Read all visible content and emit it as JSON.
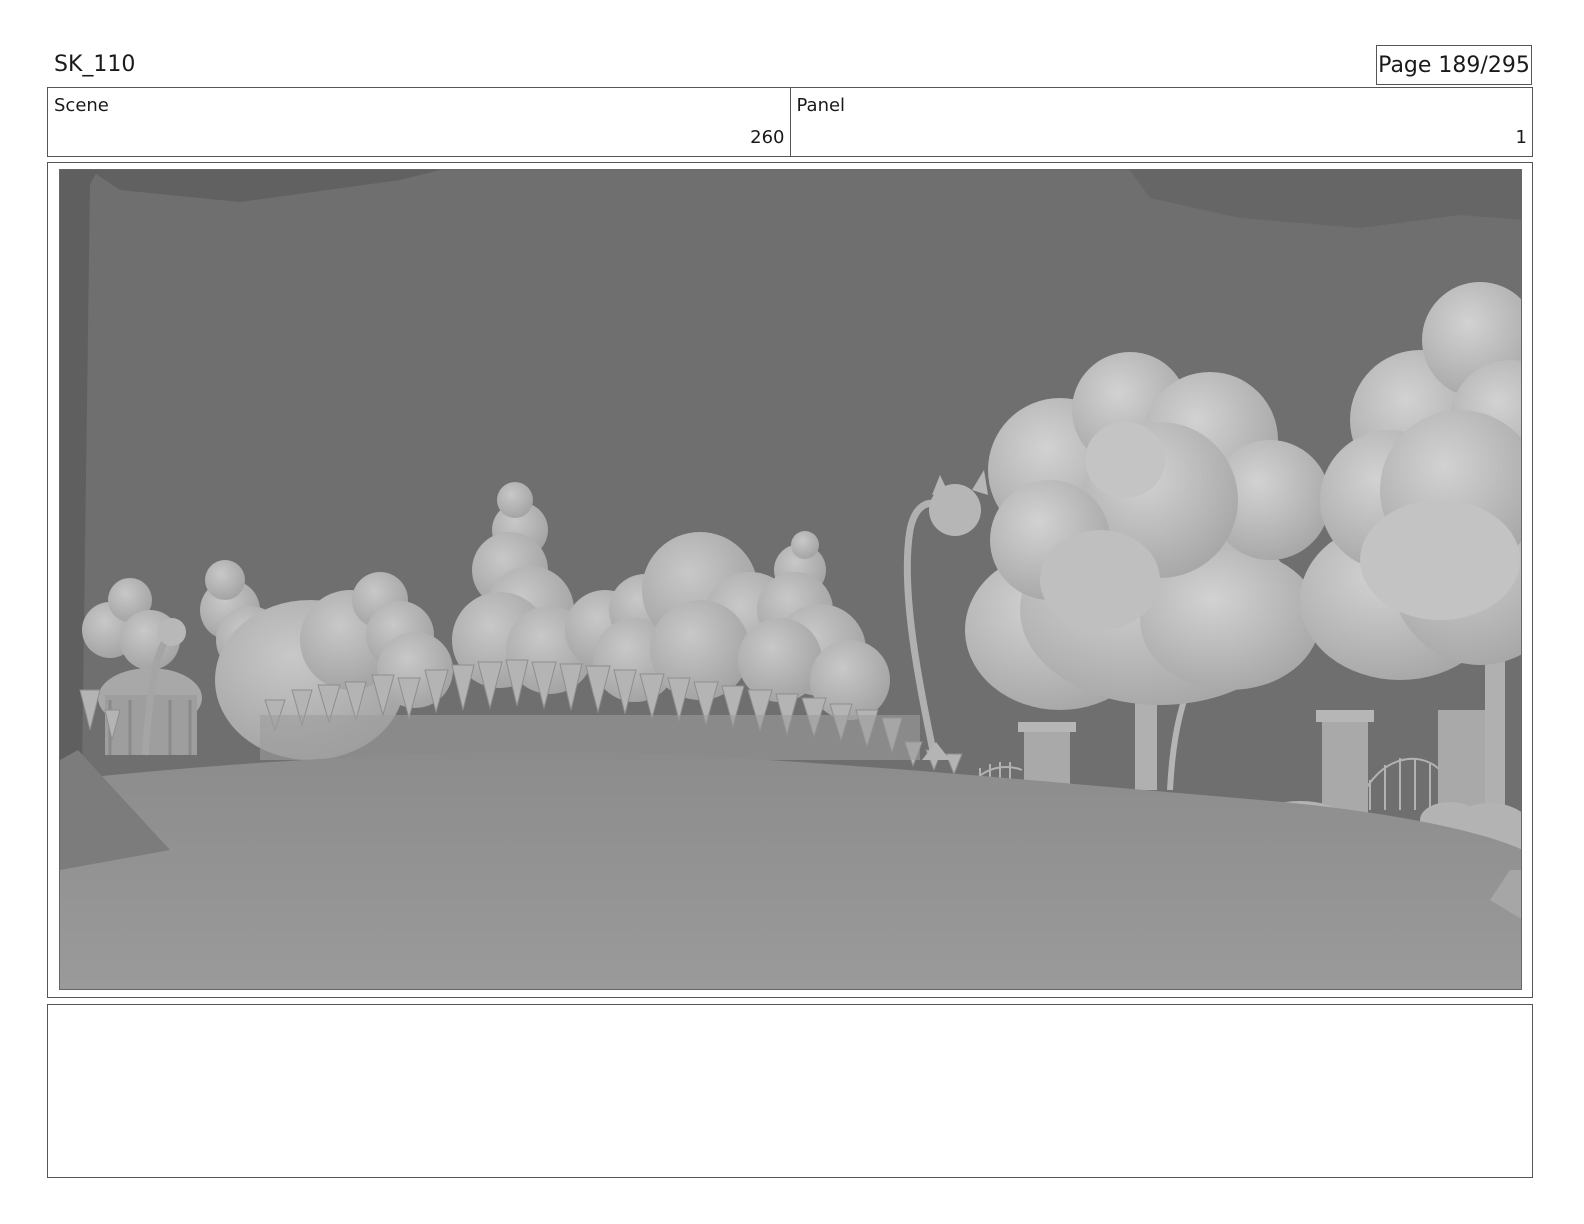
{
  "header": {
    "sheet_id": "SK_110",
    "page_label": "Page 189/295"
  },
  "info": {
    "scene_label": "Scene",
    "scene_value": "260",
    "panel_label": "Panel",
    "panel_value": "1"
  },
  "notes": {
    "text": ""
  }
}
